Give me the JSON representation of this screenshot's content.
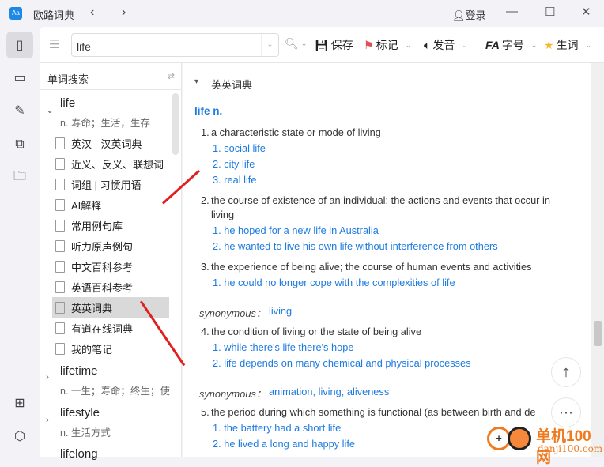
{
  "app": {
    "title": "欧路词典",
    "login": "登录",
    "logo": "Aa"
  },
  "toolbar": {
    "search_value": "life",
    "save": "保存",
    "mark": "标记",
    "speak": "发音",
    "font": "字号",
    "vocab": "生词"
  },
  "wordlist": {
    "header": "单词搜索",
    "entries": [
      {
        "word": "life",
        "def": "n. 寿命；生活，生存",
        "expanded": true
      },
      {
        "word": "lifetime",
        "def": "n. 一生；寿命；终生；使"
      },
      {
        "word": "lifestyle",
        "def": "n. 生活方式"
      },
      {
        "word": "lifelong",
        "def": ""
      }
    ],
    "dicts": [
      "英汉 - 汉英词典",
      "近义、反义、联想词",
      "词组 | 习惯用语",
      "AI解释",
      "常用例句库",
      "听力原声例句",
      "中文百科参考",
      "英语百科参考",
      "英英词典",
      "有道在线词典",
      "我的笔记"
    ],
    "selected": "英英词典"
  },
  "content": {
    "section": "英英词典",
    "headword": "life n.",
    "senses": [
      {
        "n": "1.",
        "def": "a characteristic state or mode of living",
        "ex": [
          "1. social life",
          "2. city life",
          "3. real life"
        ]
      },
      {
        "n": "2.",
        "def": "the course of existence of an individual; the actions and events that occur in",
        "def2": "living",
        "ex": [
          "1. he hoped for a new life in Australia",
          "2. he wanted to live his own life without interference from others"
        ]
      },
      {
        "n": "3.",
        "def": "the experience of being alive; the course of human events and activities",
        "ex": [
          "1. he could no longer cope with the complexities of life"
        ]
      },
      {
        "n": "4.",
        "def": "the condition of living or the state of being alive",
        "ex": [
          "1. while there's life there's hope",
          "2. life depends on many chemical and physical processes"
        ]
      },
      {
        "n": "5.",
        "def": "the period during which something is functional (as between birth and de",
        "ex": [
          "1. the battery had a short life",
          "2. he lived a long and happy life"
        ]
      }
    ],
    "syn_label": "synonymous：",
    "syn1": "living",
    "syn2": "animation, living, aliveness"
  },
  "watermark": {
    "cn": "单机100网",
    "url": "danji100.com"
  },
  "colors": {
    "link": "#1e7be0",
    "arrow": "#e02020",
    "accent": "#1e88e5"
  }
}
